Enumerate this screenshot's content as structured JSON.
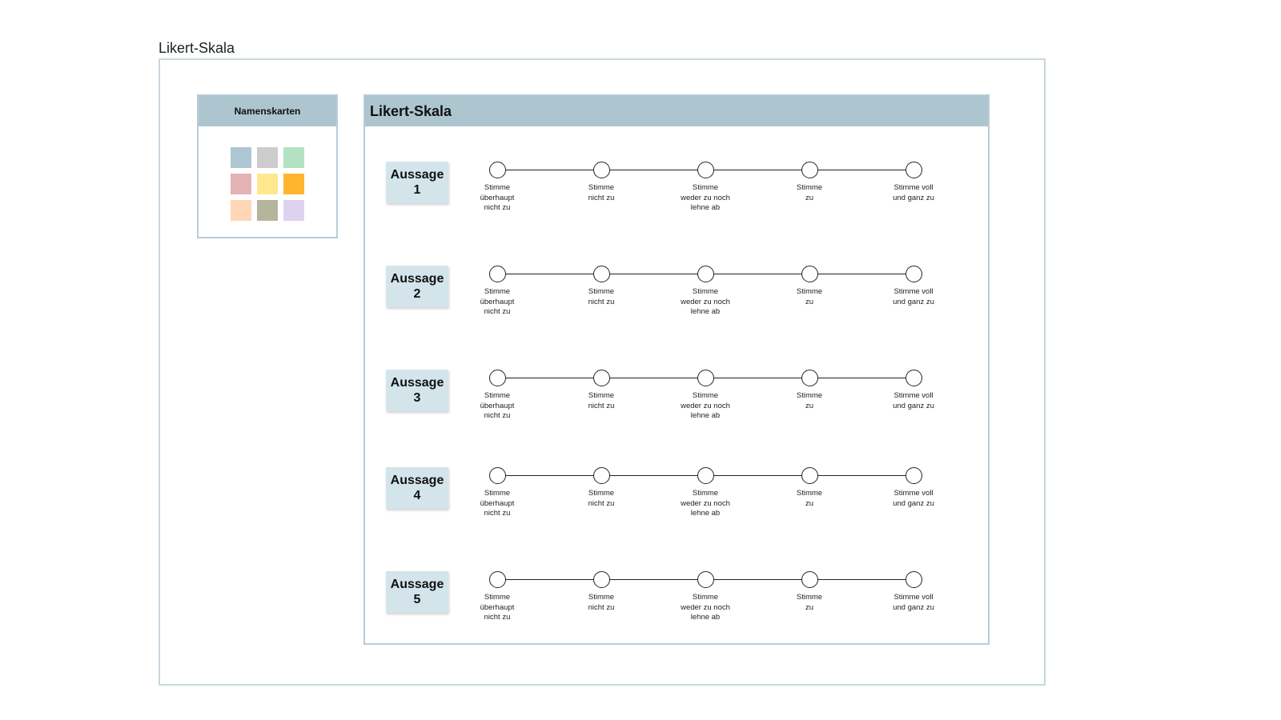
{
  "frame": {
    "title": "Likert-Skala"
  },
  "name_cards": {
    "title": "Namenskarten",
    "swatches": [
      "#aec6d1",
      "#cccccc",
      "#b2e2c2",
      "#e4b3b6",
      "#ffe78f",
      "#ffb52e",
      "#ffd6b6",
      "#b5b59e",
      "#ddd2ef"
    ]
  },
  "likert": {
    "title": "Likert-Skala",
    "statements": [
      {
        "label": "Aussage",
        "number": "1"
      },
      {
        "label": "Aussage",
        "number": "2"
      },
      {
        "label": "Aussage",
        "number": "3"
      },
      {
        "label": "Aussage",
        "number": "4"
      },
      {
        "label": "Aussage",
        "number": "5"
      }
    ],
    "scale": [
      "Stimme\nüberhaupt\nnicht zu",
      "Stimme\nnicht zu",
      "Stimme\nweder zu noch\nlehne ab",
      "Stimme\nzu",
      "Stimme voll\nund ganz zu"
    ]
  }
}
